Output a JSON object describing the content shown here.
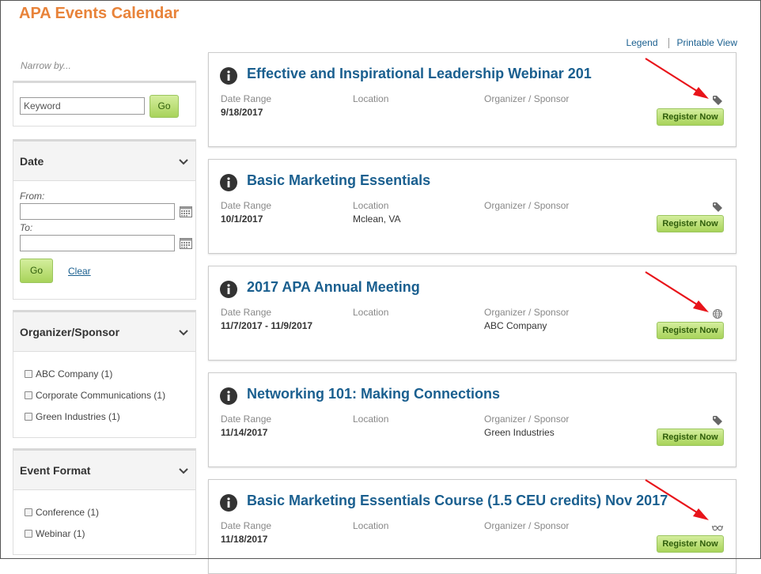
{
  "page": {
    "title": "APA Events Calendar"
  },
  "top_links": {
    "legend": "Legend",
    "printable": "Printable View"
  },
  "sidebar": {
    "narrow_label": "Narrow by...",
    "keyword": {
      "placeholder": "Keyword",
      "go": "Go"
    },
    "date": {
      "title": "Date",
      "from_label": "From:",
      "to_label": "To:",
      "go": "Go",
      "clear": "Clear"
    },
    "organizer": {
      "title": "Organizer/Sponsor",
      "options": [
        "ABC Company (1)",
        "Corporate Communications (1)",
        "Green Industries (1)"
      ]
    },
    "format": {
      "title": "Event Format",
      "options": [
        "Conference (1)",
        "Webinar (1)"
      ]
    }
  },
  "labels": {
    "date_range": "Date Range",
    "location": "Location",
    "organizer": "Organizer / Sponsor",
    "register": "Register Now"
  },
  "events": [
    {
      "title": "Effective and Inspirational Leadership Webinar 201",
      "date": "9/18/2017",
      "location": "",
      "organizer": "",
      "icon": "tag-icon"
    },
    {
      "title": "Basic Marketing Essentials",
      "date": "10/1/2017",
      "location": "Mclean, VA",
      "organizer": "",
      "icon": "tag-icon"
    },
    {
      "title": "2017 APA Annual Meeting",
      "date": "11/7/2017 - 11/9/2017",
      "location": "",
      "organizer": "ABC Company",
      "icon": "globe-icon"
    },
    {
      "title": "Networking 101: Making Connections",
      "date": "11/14/2017",
      "location": "",
      "organizer": "Green Industries",
      "icon": "tag-icon"
    },
    {
      "title": "Basic Marketing Essentials Course (1.5 CEU credits) Nov 2017",
      "date": "11/18/2017",
      "location": "",
      "organizer": "",
      "icon": "glasses-icon"
    }
  ],
  "colors": {
    "title_orange": "#e8833a",
    "link_blue": "#1a5f8f",
    "button_green": "#a8d35a",
    "annotation_red": "#e8141a"
  }
}
